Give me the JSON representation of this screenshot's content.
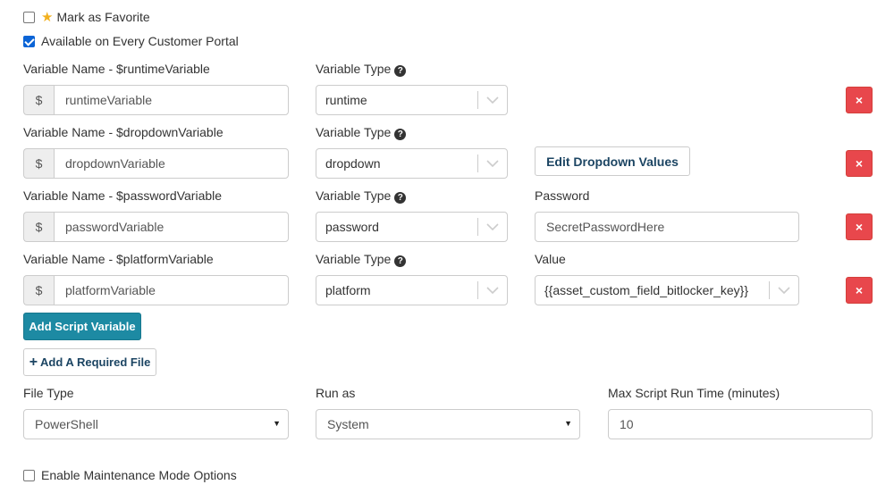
{
  "checkboxes": {
    "favorite": {
      "label": "Mark as Favorite",
      "checked": false
    },
    "portal": {
      "label": "Available on Every Customer Portal",
      "checked": true
    },
    "maintenance": {
      "label": "Enable Maintenance Mode Options",
      "checked": false
    }
  },
  "variables": [
    {
      "name_label": "Variable Name - $runtimeVariable",
      "prefix": "$",
      "name_value": "runtimeVariable",
      "type_label": "Variable Type",
      "type_value": "runtime"
    },
    {
      "name_label": "Variable Name - $dropdownVariable",
      "prefix": "$",
      "name_value": "dropdownVariable",
      "type_label": "Variable Type",
      "type_value": "dropdown",
      "extra_button": "Edit Dropdown Values"
    },
    {
      "name_label": "Variable Name - $passwordVariable",
      "prefix": "$",
      "name_value": "passwordVariable",
      "type_label": "Variable Type",
      "type_value": "password",
      "extra_label": "Password",
      "extra_value": "SecretPasswordHere"
    },
    {
      "name_label": "Variable Name - $platformVariable",
      "prefix": "$",
      "name_value": "platformVariable",
      "type_label": "Variable Type",
      "type_value": "platform",
      "extra_label": "Value",
      "extra_value": "{{asset_custom_field_bitlocker_key}}"
    }
  ],
  "delete_symbol": "×",
  "help_symbol": "?",
  "buttons": {
    "add_variable": "Add Script Variable",
    "add_file_icon": "+",
    "add_file": "Add A Required File"
  },
  "settings": {
    "file_type_label": "File Type",
    "file_type_value": "PowerShell",
    "run_as_label": "Run as",
    "run_as_value": "System",
    "max_time_label": "Max Script Run Time (minutes)",
    "max_time_value": "10"
  },
  "select_caret": "▼",
  "colors": {
    "danger": "#e8474c",
    "primary": "#1d8aa3",
    "star": "#f2b01e",
    "checkbox_checked": "#0b64d6"
  }
}
